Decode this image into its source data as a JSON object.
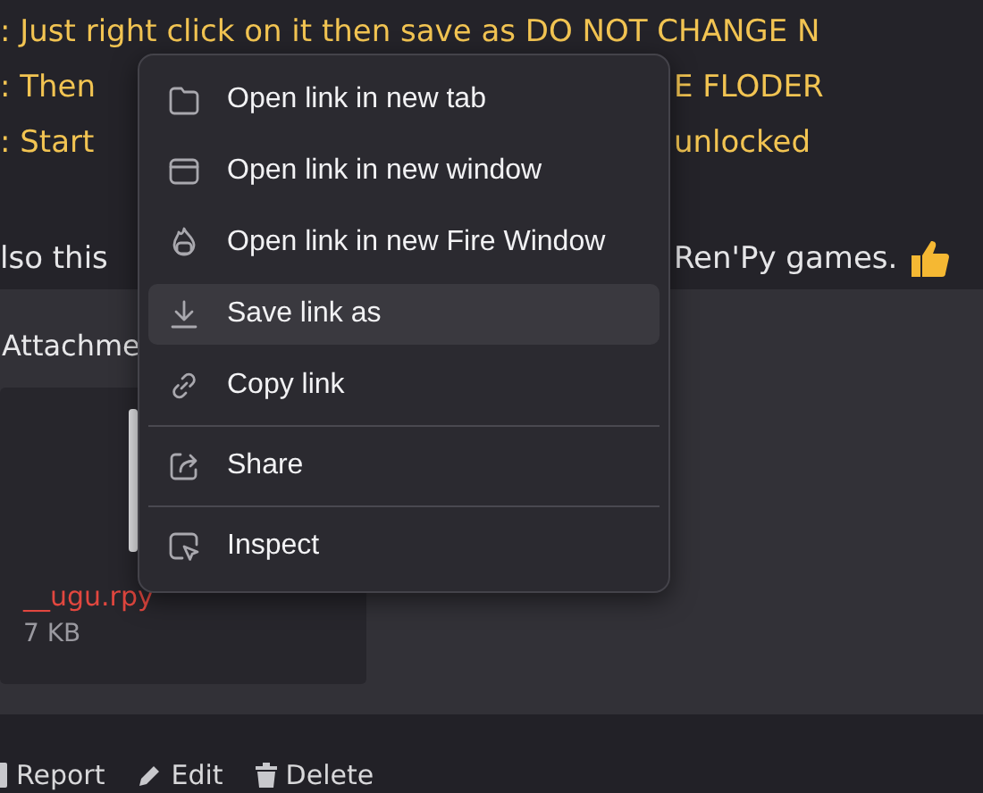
{
  "post_lines": [
    {
      "kind": "notice",
      "parts": [
        ": Just right click on it then save as DO NOT CHANGE N"
      ]
    },
    {
      "kind": "notice",
      "parts": [
        ": Then",
        "E FLODER"
      ]
    },
    {
      "kind": "notice",
      "parts": [
        ": Start",
        "unlocked"
      ]
    },
    {
      "kind": "plain",
      "parts": [
        "lso this",
        "Ren'Py games."
      ]
    }
  ],
  "attachments": {
    "heading": "Attachme",
    "files": [
      {
        "name": "__ugu.rpy",
        "size": "7 KB"
      }
    ]
  },
  "post_actions": [
    {
      "kind": "report",
      "label": "Report"
    },
    {
      "kind": "edit",
      "label": "Edit"
    },
    {
      "kind": "delete",
      "label": "Delete"
    }
  ],
  "context_menu": [
    {
      "kind": "tab",
      "label": "Open link in new tab",
      "selected": false
    },
    {
      "kind": "window",
      "label": "Open link in new window",
      "selected": false
    },
    {
      "kind": "fire",
      "label": "Open link in new Fire Window",
      "selected": false
    },
    {
      "kind": "save",
      "label": "Save link as",
      "selected": true
    },
    {
      "kind": "copy",
      "label": "Copy link",
      "selected": false
    },
    {
      "kind": "share",
      "label": "Share",
      "selected": false,
      "separator_before": true
    },
    {
      "kind": "inspect",
      "label": "Inspect",
      "selected": false,
      "separator_before": true
    }
  ]
}
